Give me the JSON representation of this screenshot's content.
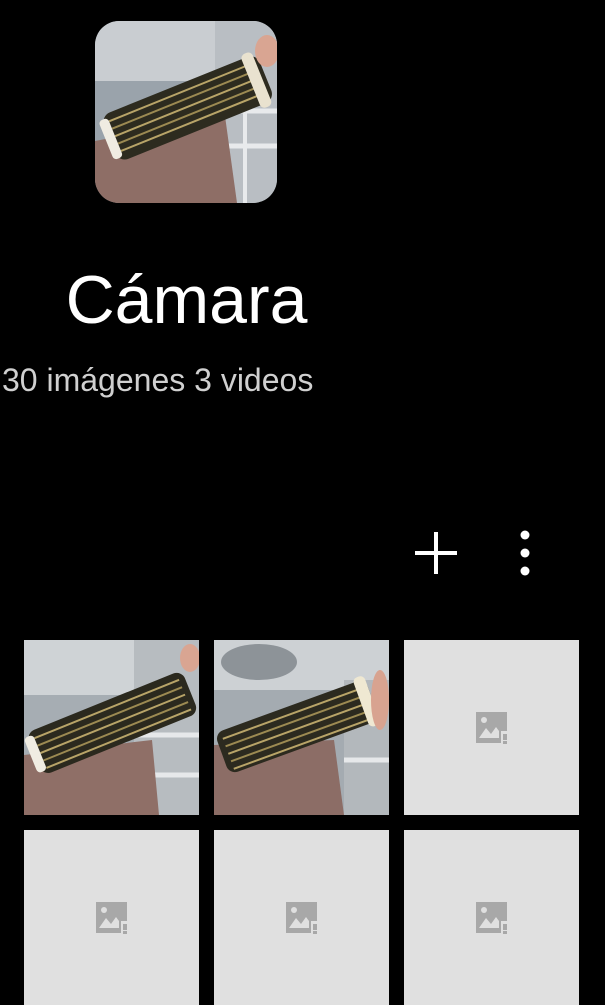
{
  "album": {
    "title": "Cámara",
    "count_text": "30 imágenes 3 videos"
  },
  "actions": {
    "add_icon": "plus-icon",
    "more_icon": "more-vert-icon"
  },
  "grid": {
    "items": [
      {
        "type": "photo",
        "subject": "pleated-filter-held"
      },
      {
        "type": "photo",
        "subject": "pleated-filter-held"
      },
      {
        "type": "placeholder",
        "icon": "broken-image-icon"
      },
      {
        "type": "placeholder",
        "icon": "broken-image-icon"
      },
      {
        "type": "placeholder",
        "icon": "broken-image-icon"
      },
      {
        "type": "placeholder",
        "icon": "broken-image-icon"
      }
    ]
  },
  "colors": {
    "background": "#000000",
    "title": "#ffffff",
    "subtitle": "#d0d0d0",
    "placeholder_bg": "#e0e0e0",
    "placeholder_icon": "#a8a8a8"
  }
}
